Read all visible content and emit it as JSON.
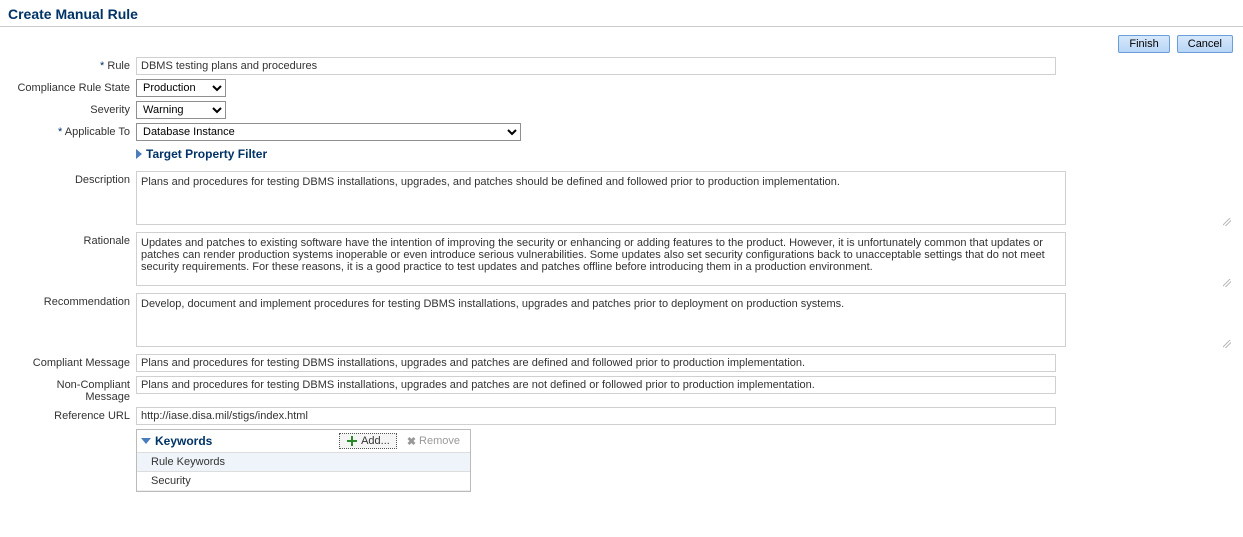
{
  "header": {
    "title": "Create Manual Rule"
  },
  "buttons": {
    "finish": "Finish",
    "cancel": "Cancel"
  },
  "labels": {
    "rule": "Rule",
    "state": "Compliance Rule State",
    "severity": "Severity",
    "applicable": "Applicable To",
    "filter": "Target Property Filter",
    "description": "Description",
    "rationale": "Rationale",
    "recommendation": "Recommendation",
    "compliant": "Compliant Message",
    "noncompliant": "Non-Compliant Message",
    "refurl": "Reference URL"
  },
  "fields": {
    "rule": "DBMS testing plans and procedures",
    "state": "Production",
    "severity": "Warning",
    "applicable": "Database Instance",
    "description": "Plans and procedures for testing DBMS installations, upgrades, and patches should be defined and followed prior to production implementation.",
    "rationale": "Updates and patches to existing software have the intention of improving the security or enhancing or adding features to the product. However, it is unfortunately common that updates or patches can render production systems inoperable or even introduce serious vulnerabilities. Some updates also set security configurations back to unacceptable settings that do not meet security requirements. For these reasons, it is a good practice to test updates and patches offline before introducing them in a production environment.",
    "recommendation": "Develop, document and implement procedures for testing DBMS installations, upgrades and patches prior to deployment on production systems.",
    "compliant": "Plans and procedures for testing DBMS installations, upgrades and patches are defined and followed prior to production implementation.",
    "noncompliant": "Plans and procedures for testing DBMS installations, upgrades and patches are not defined or followed prior to production implementation.",
    "refurl": "http://iase.disa.mil/stigs/index.html"
  },
  "keywords": {
    "title": "Keywords",
    "add": "Add...",
    "remove": "Remove",
    "colhead": "Rule Keywords",
    "items": [
      "Security"
    ]
  }
}
